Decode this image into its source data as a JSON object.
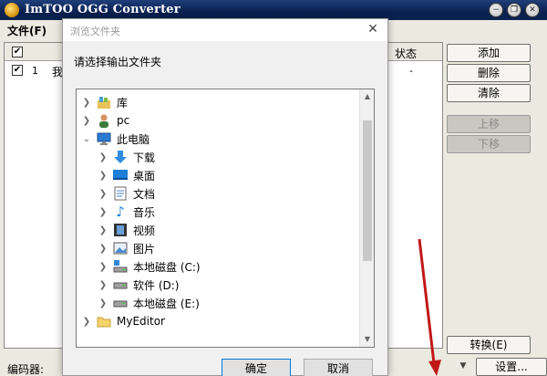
{
  "app": {
    "title": "ImTOO OGG Converter"
  },
  "window_controls": {
    "minimize": "−",
    "restore": "❐",
    "close": "✕"
  },
  "menu": {
    "file": "文件(F)"
  },
  "file_list": {
    "columns": {
      "status": "状态"
    },
    "rows": [
      {
        "num": "1",
        "name": "我的",
        "status": "-"
      }
    ]
  },
  "side_buttons": {
    "add": "添加",
    "delete": "删除",
    "clear": "清除",
    "move_up": "上移",
    "move_down": "下移",
    "convert": "转换(E)"
  },
  "bottom": {
    "encoder_label": "编码器:",
    "settings": "设置..."
  },
  "dialog": {
    "title": "浏览文件夹",
    "prompt": "请选择输出文件夹",
    "tree": [
      {
        "label": "库",
        "icon": "library-icon",
        "level": 0,
        "expanded": false
      },
      {
        "label": "pc",
        "icon": "user-icon",
        "level": 0,
        "expanded": false
      },
      {
        "label": "此电脑",
        "icon": "computer-icon",
        "level": 0,
        "expanded": true
      },
      {
        "label": "下载",
        "icon": "download-icon",
        "level": 1,
        "expanded": false
      },
      {
        "label": "桌面",
        "icon": "desktop-icon",
        "level": 1,
        "expanded": false
      },
      {
        "label": "文档",
        "icon": "document-icon",
        "level": 1,
        "expanded": false
      },
      {
        "label": "音乐",
        "icon": "music-icon",
        "level": 1,
        "expanded": false
      },
      {
        "label": "视频",
        "icon": "video-icon",
        "level": 1,
        "expanded": false
      },
      {
        "label": "图片",
        "icon": "picture-icon",
        "level": 1,
        "expanded": false
      },
      {
        "label": "本地磁盘 (C:)",
        "icon": "system-drive-icon",
        "level": 1,
        "expanded": false
      },
      {
        "label": "软件 (D:)",
        "icon": "drive-icon",
        "level": 1,
        "expanded": false
      },
      {
        "label": "本地磁盘 (E:)",
        "icon": "drive-icon",
        "level": 1,
        "expanded": false
      },
      {
        "label": "MyEditor",
        "icon": "folder-icon",
        "level": 0,
        "expanded": false
      }
    ],
    "ok": "确定",
    "cancel": "取消"
  },
  "colors": {
    "titlebar": "#0a2050",
    "dialog_primary_border": "#0078d7",
    "annotation_arrow": "#c01818"
  }
}
